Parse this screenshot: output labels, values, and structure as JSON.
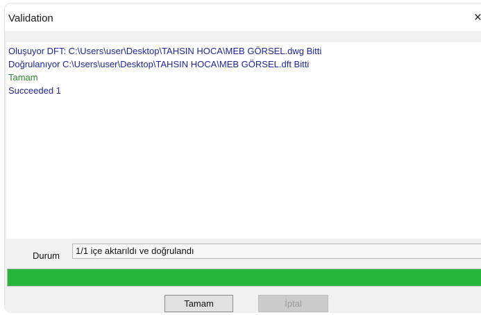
{
  "window": {
    "title": "Validation",
    "close_glyph": "×",
    "close_icon": "close-icon"
  },
  "log": {
    "lines": [
      {
        "text": "Oluşuyor DFT: C:\\Users\\user\\Desktop\\TAHSIN HOCA\\MEB GÖRSEL.dwg   Bitti",
        "color": "#1d24a0"
      },
      {
        "text": "Doğrulanıyor C:\\Users\\user\\Desktop\\TAHSIN HOCA\\MEB GÖRSEL.dft   Bitti",
        "color": "#1d24a0"
      },
      {
        "text": "Tamam",
        "color": "#2b8a2b"
      },
      {
        "text": "Succeeded 1",
        "color": "#1d24a0"
      }
    ]
  },
  "status": {
    "label": "Durum",
    "value": "1/1 içe aktarıldı ve doğrulandı"
  },
  "progress": {
    "percent": 100,
    "color": "#25b53a"
  },
  "buttons": {
    "ok_label": "Tamam",
    "cancel_label": "İptal"
  }
}
